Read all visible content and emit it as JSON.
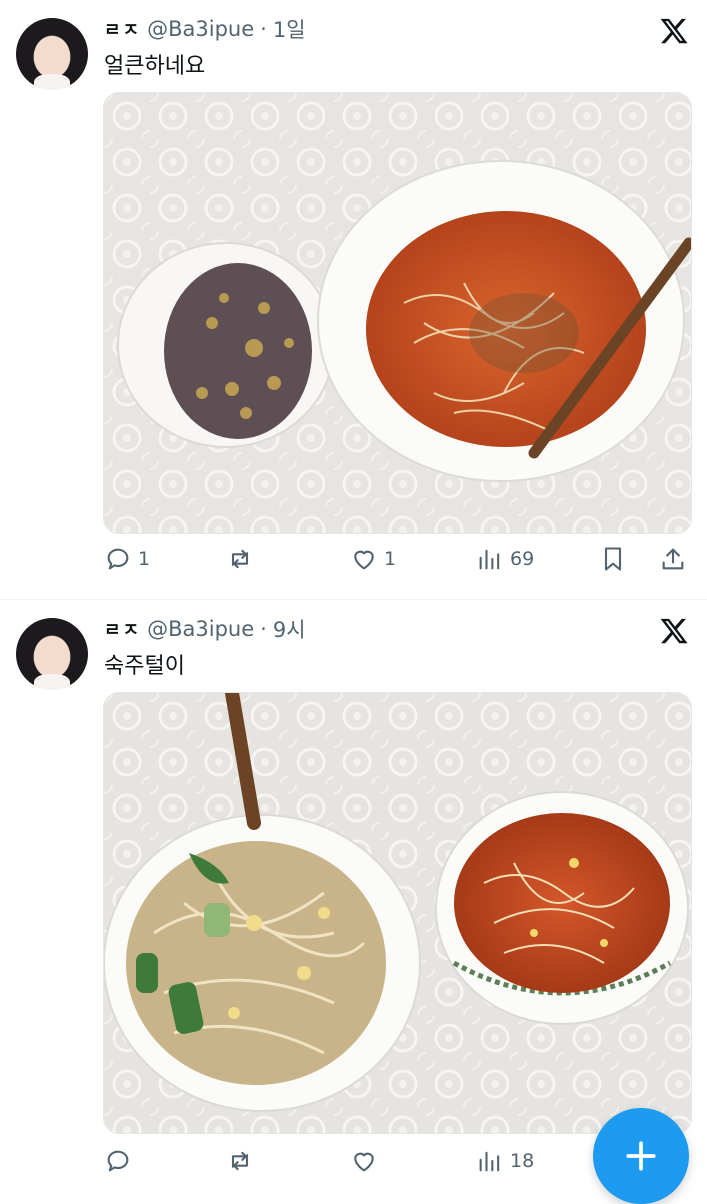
{
  "tweets": [
    {
      "display_name": "ㄹㅈ",
      "handle": "@Ba3ipue",
      "separator": "·",
      "time": "1일",
      "text": "얼큰하네요",
      "stats": {
        "replies": "1",
        "reposts": "",
        "likes": "1",
        "views": "69"
      }
    },
    {
      "display_name": "ㄹㅈ",
      "handle": "@Ba3ipue",
      "separator": "·",
      "time": "9시",
      "text": "숙주털이",
      "stats": {
        "replies": "",
        "reposts": "",
        "likes": "",
        "views": "18"
      }
    }
  ],
  "icons": {
    "platform": "x-logo-icon",
    "reply": "reply-icon",
    "repost": "repost-icon",
    "like": "heart-icon",
    "views": "views-icon",
    "bookmark": "bookmark-icon",
    "share": "share-icon",
    "compose": "plus-icon"
  },
  "colors": {
    "accent": "#1d9bf0",
    "muted": "#536471",
    "text": "#0f1419"
  }
}
